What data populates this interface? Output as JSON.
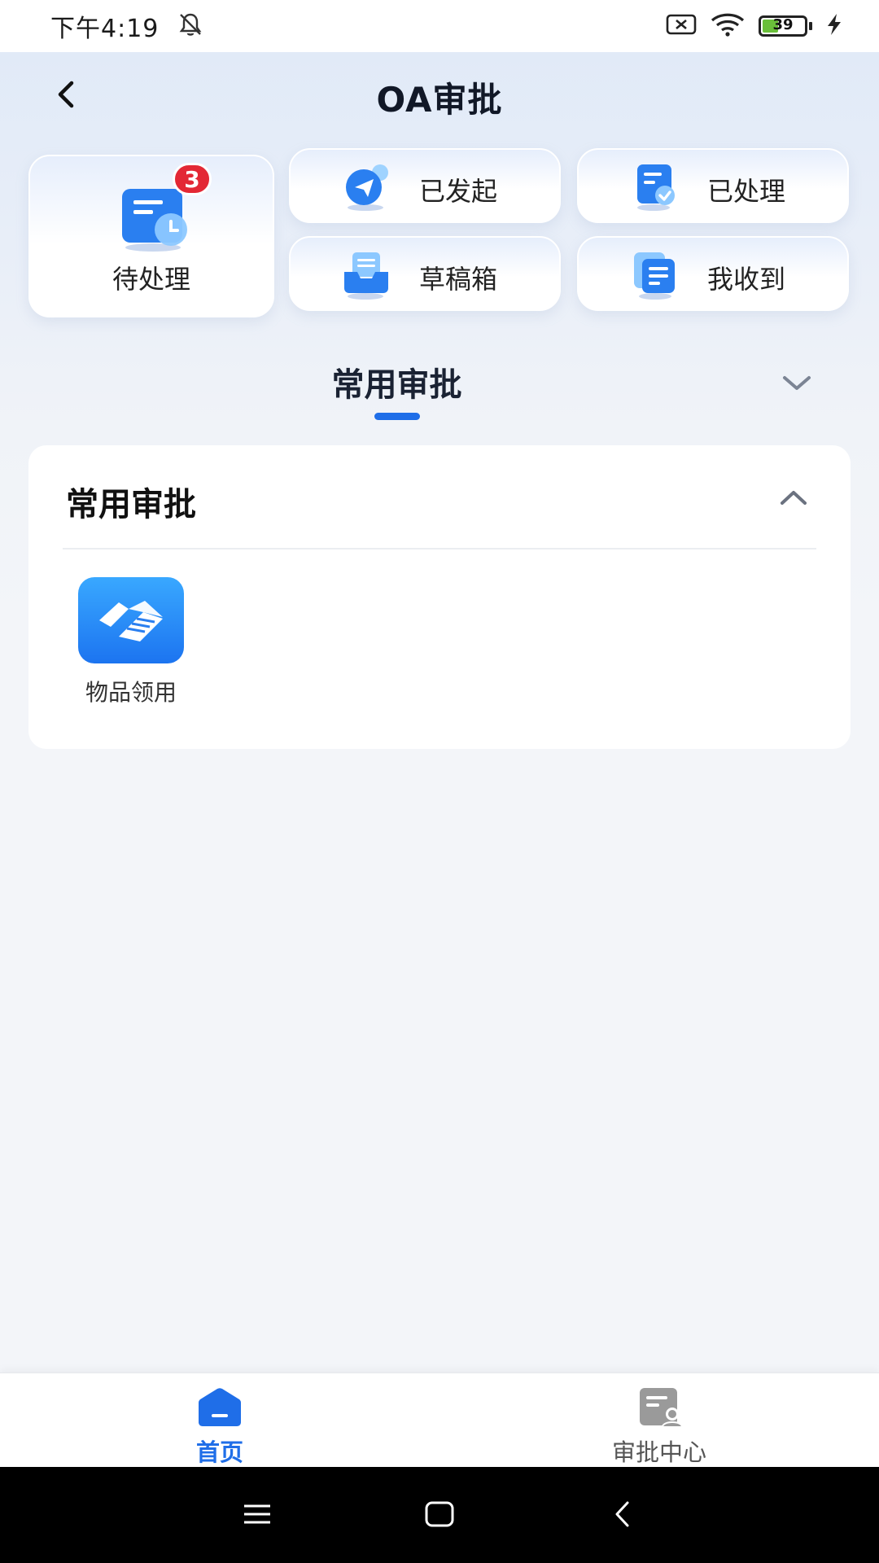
{
  "status_bar": {
    "time": "下午4:19",
    "battery_level": "39",
    "battery_percent": 39,
    "icons": [
      "bell-off-icon",
      "sim-x-icon",
      "wifi-icon",
      "battery-icon",
      "charging-icon"
    ]
  },
  "header": {
    "title": "OA审批",
    "back_icon": "chevron-left-icon"
  },
  "quick_tiles": {
    "pending": {
      "label": "待处理",
      "badge": "3",
      "icon": "pending-doc-clock-icon"
    },
    "initiated": {
      "label": "已发起",
      "icon": "paper-plane-icon"
    },
    "processed": {
      "label": "已处理",
      "icon": "doc-check-icon"
    },
    "drafts": {
      "label": "草稿箱",
      "icon": "inbox-tray-icon"
    },
    "received": {
      "label": "我收到",
      "icon": "doc-received-icon"
    }
  },
  "tab": {
    "title": "常用审批",
    "chevron_icon": "chevron-down-icon"
  },
  "card": {
    "title": "常用审批",
    "chevron_icon": "chevron-up-icon",
    "apps": [
      {
        "label": "物品领用",
        "icon": "handshake-icon"
      }
    ]
  },
  "bottom_nav": {
    "items": [
      {
        "label": "首页",
        "icon": "home-icon",
        "active": true
      },
      {
        "label": "审批中心",
        "icon": "approval-center-icon",
        "active": false
      }
    ]
  },
  "system_nav": {
    "icons": [
      "menu-icon",
      "home-square-icon",
      "back-icon"
    ]
  },
  "colors": {
    "accent": "#1f6ee8",
    "badge": "#e32835",
    "battery_fill": "#6abf3a"
  }
}
